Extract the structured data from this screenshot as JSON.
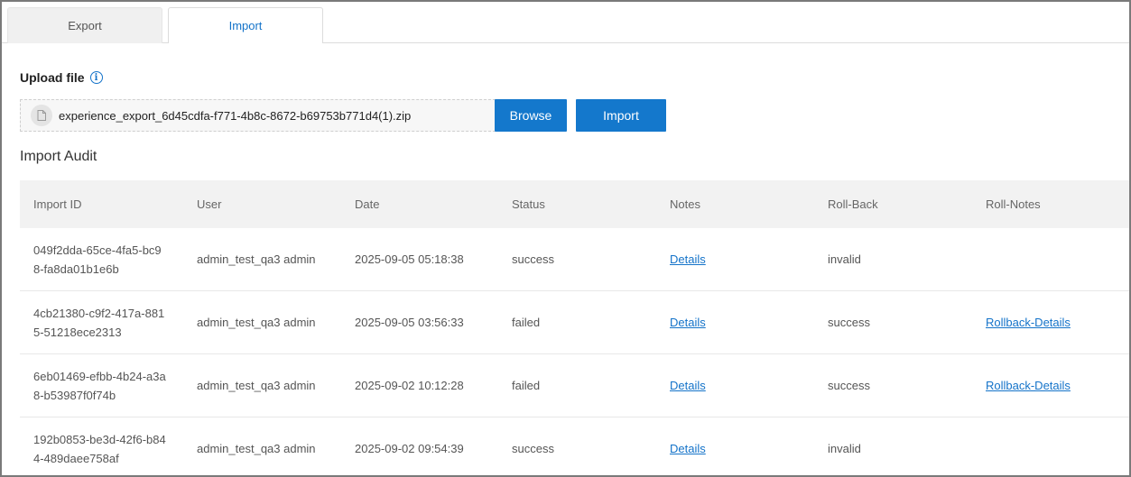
{
  "tabs": [
    {
      "label": "Export",
      "active": false
    },
    {
      "label": "Import",
      "active": true
    }
  ],
  "upload": {
    "title": "Upload file",
    "file_name": "experience_export_6d45cdfa-f771-4b8c-8672-b69753b771d4(1).zip",
    "browse_label": "Browse",
    "import_label": "Import"
  },
  "audit": {
    "title": "Import Audit",
    "columns": [
      "Import ID",
      "User",
      "Date",
      "Status",
      "Notes",
      "Roll-Back",
      "Roll-Notes"
    ],
    "rows": [
      {
        "id_line1": "049f2dda-65ce-4fa5-bc9",
        "id_line2": "8-fa8da01b1e6b",
        "user": "admin_test_qa3 admin",
        "date": "2025-09-05 05:18:38",
        "status": "success",
        "notes": "Details",
        "rollback": "invalid",
        "roll_notes": ""
      },
      {
        "id_line1": "4cb21380-c9f2-417a-881",
        "id_line2": "5-51218ece2313",
        "user": "admin_test_qa3 admin",
        "date": "2025-09-05 03:56:33",
        "status": "failed",
        "notes": "Details",
        "rollback": "success",
        "roll_notes": "Rollback-Details"
      },
      {
        "id_line1": "6eb01469-efbb-4b24-a3a",
        "id_line2": "8-b53987f0f74b",
        "user": "admin_test_qa3 admin",
        "date": "2025-09-02 10:12:28",
        "status": "failed",
        "notes": "Details",
        "rollback": "success",
        "roll_notes": "Rollback-Details"
      },
      {
        "id_line1": "192b0853-be3d-42f6-b84",
        "id_line2": "4-489daee758af",
        "user": "admin_test_qa3 admin",
        "date": "2025-09-02 09:54:39",
        "status": "success",
        "notes": "Details",
        "rollback": "invalid",
        "roll_notes": ""
      }
    ]
  },
  "colors": {
    "accent": "#1478cc",
    "link": "#1473c9"
  }
}
